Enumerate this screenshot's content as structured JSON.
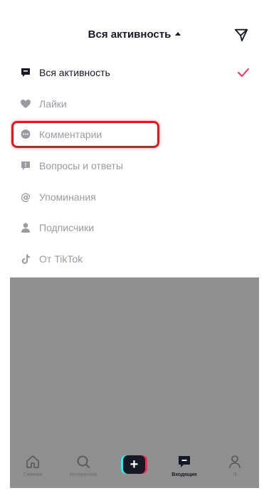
{
  "header": {
    "title": "Вся активность"
  },
  "menu": {
    "items": [
      {
        "label": "Вся активность",
        "icon": "message-square-icon",
        "active": true
      },
      {
        "label": "Лайки",
        "icon": "heart-icon"
      },
      {
        "label": "Комментарии",
        "icon": "comment-icon"
      },
      {
        "label": "Вопросы и ответы",
        "icon": "question-icon"
      },
      {
        "label": "Упоминания",
        "icon": "at-icon"
      },
      {
        "label": "Подписчики",
        "icon": "person-icon"
      },
      {
        "label": "От TikTok",
        "icon": "tiktok-icon"
      }
    ]
  },
  "tabbar": {
    "home_label": "Главная",
    "discover_label": "Интересное",
    "create_label": "+",
    "inbox_label": "Входящие",
    "profile_label": "Я"
  },
  "colors": {
    "accent": "#fe2c55",
    "highlight": "#e0191f",
    "overlay": "#8f8f8f",
    "text": "#161823",
    "muted": "#9a9aa0"
  }
}
